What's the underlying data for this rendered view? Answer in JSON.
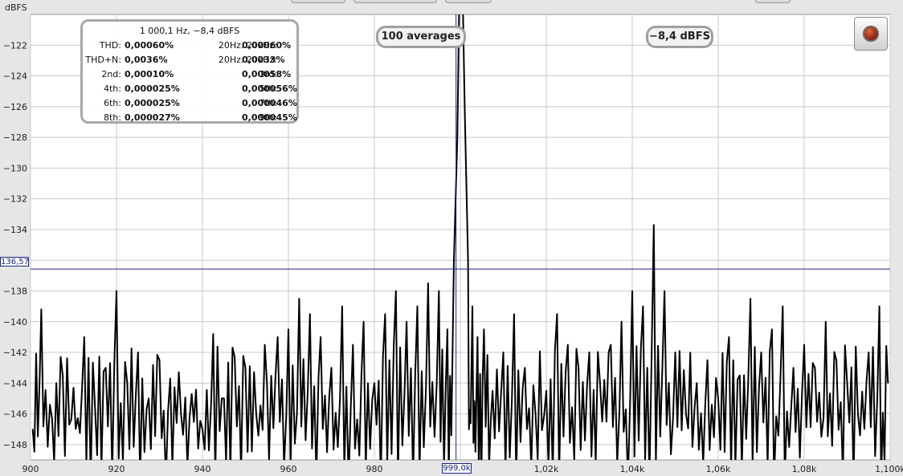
{
  "chart_data": {
    "type": "line",
    "title": "",
    "xlabel": "",
    "ylabel": "dBFS",
    "xlim": [
      900,
      1100
    ],
    "ylim": [
      -149,
      -120
    ],
    "grid": true,
    "x_ticks": [
      {
        "v": 900,
        "label": "900"
      },
      {
        "v": 920,
        "label": "920"
      },
      {
        "v": 940,
        "label": "940"
      },
      {
        "v": 960,
        "label": "960"
      },
      {
        "v": 980,
        "label": "980"
      },
      {
        "v": 1000,
        "label": "999,0k"
      },
      {
        "v": 1020,
        "label": "1,02k"
      },
      {
        "v": 1040,
        "label": "1,04k"
      },
      {
        "v": 1060,
        "label": "1,06k"
      },
      {
        "v": 1080,
        "label": "1,08k"
      },
      {
        "v": 1100,
        "label": "1,100k"
      }
    ],
    "y_ticks": [
      {
        "v": -122,
        "label": "−122"
      },
      {
        "v": -124,
        "label": "−124"
      },
      {
        "v": -126,
        "label": "−126"
      },
      {
        "v": -128,
        "label": "−128"
      },
      {
        "v": -130,
        "label": "−130"
      },
      {
        "v": -132,
        "label": "−132"
      },
      {
        "v": -134,
        "label": "−134"
      },
      {
        "v": -136,
        "label": "−136"
      },
      {
        "v": -138,
        "label": "−138"
      },
      {
        "v": -140,
        "label": "−140"
      },
      {
        "v": -142,
        "label": "−142"
      },
      {
        "v": -144,
        "label": "−144"
      },
      {
        "v": -146,
        "label": "−146"
      },
      {
        "v": -148,
        "label": "−148"
      }
    ],
    "cursor": {
      "x": 999.0,
      "y": -136.57,
      "y_label": "136,57",
      "x_label": "999,0k",
      "color": "#1a237e"
    },
    "series": [
      {
        "color": "#000000",
        "peaks": [
          {
            "x": 900.5,
            "y": -147.0
          },
          {
            "x": 902.5,
            "y": -139.2
          },
          {
            "x": 905.0,
            "y": -146.3
          },
          {
            "x": 907.5,
            "y": -143.5
          },
          {
            "x": 910.0,
            "y": -144.3
          },
          {
            "x": 912.5,
            "y": -141.0
          },
          {
            "x": 915.0,
            "y": -145.6
          },
          {
            "x": 917.5,
            "y": -143.0
          },
          {
            "x": 920.0,
            "y": -138.0
          },
          {
            "x": 922.5,
            "y": -144.0
          },
          {
            "x": 925.0,
            "y": -142.0
          },
          {
            "x": 927.5,
            "y": -145.0
          },
          {
            "x": 930.0,
            "y": -142.5
          },
          {
            "x": 932.5,
            "y": -143.7
          },
          {
            "x": 935.0,
            "y": -146.0
          },
          {
            "x": 937.5,
            "y": -144.7
          },
          {
            "x": 940.0,
            "y": -147.0
          },
          {
            "x": 942.5,
            "y": -140.8
          },
          {
            "x": 945.0,
            "y": -145.0
          },
          {
            "x": 947.5,
            "y": -142.3
          },
          {
            "x": 950.0,
            "y": -143.0
          },
          {
            "x": 952.5,
            "y": -146.0
          },
          {
            "x": 955.0,
            "y": -144.0
          },
          {
            "x": 957.5,
            "y": -141.0
          },
          {
            "x": 960.0,
            "y": -140.5
          },
          {
            "x": 962.5,
            "y": -138.5
          },
          {
            "x": 965.0,
            "y": -139.5
          },
          {
            "x": 967.5,
            "y": -141.0
          },
          {
            "x": 970.0,
            "y": -143.0
          },
          {
            "x": 972.5,
            "y": -139.0
          },
          {
            "x": 975.0,
            "y": -141.5
          },
          {
            "x": 977.5,
            "y": -140.0
          },
          {
            "x": 980.0,
            "y": -144.0
          },
          {
            "x": 982.5,
            "y": -139.5
          },
          {
            "x": 985.0,
            "y": -138.0
          },
          {
            "x": 987.5,
            "y": -140.0
          },
          {
            "x": 990.0,
            "y": -139.0
          },
          {
            "x": 992.5,
            "y": -137.5
          },
          {
            "x": 995.0,
            "y": -138.0
          },
          {
            "x": 997.0,
            "y": -140.5
          },
          {
            "x": 998.5,
            "y": -136.0
          },
          {
            "x": 999.3,
            "y": -128.0
          },
          {
            "x": 999.8,
            "y": -118.0
          },
          {
            "x": 1000.1,
            "y": -110.0
          },
          {
            "x": 1000.5,
            "y": -118.0
          },
          {
            "x": 1001.0,
            "y": -126.0
          },
          {
            "x": 1001.8,
            "y": -136.0
          },
          {
            "x": 1002.8,
            "y": -139.0
          },
          {
            "x": 1004.0,
            "y": -141.0
          },
          {
            "x": 1005.5,
            "y": -140.5
          },
          {
            "x": 1007.5,
            "y": -144.5
          },
          {
            "x": 1010.0,
            "y": -142.0
          },
          {
            "x": 1012.5,
            "y": -139.5
          },
          {
            "x": 1015.0,
            "y": -143.0
          },
          {
            "x": 1017.5,
            "y": -146.0
          },
          {
            "x": 1020.0,
            "y": -144.5
          },
          {
            "x": 1022.5,
            "y": -139.5
          },
          {
            "x": 1025.0,
            "y": -141.5
          },
          {
            "x": 1027.5,
            "y": -143.0
          },
          {
            "x": 1030.0,
            "y": -142.0
          },
          {
            "x": 1032.5,
            "y": -144.0
          },
          {
            "x": 1035.0,
            "y": -141.5
          },
          {
            "x": 1037.5,
            "y": -140.0
          },
          {
            "x": 1040.0,
            "y": -138.0
          },
          {
            "x": 1042.5,
            "y": -139.0
          },
          {
            "x": 1045.0,
            "y": -133.7
          },
          {
            "x": 1047.5,
            "y": -138.0
          },
          {
            "x": 1050.0,
            "y": -142.0
          },
          {
            "x": 1052.5,
            "y": -146.0
          },
          {
            "x": 1055.0,
            "y": -144.0
          },
          {
            "x": 1057.5,
            "y": -142.5
          },
          {
            "x": 1060.0,
            "y": -145.0
          },
          {
            "x": 1062.5,
            "y": -141.0
          },
          {
            "x": 1065.0,
            "y": -143.5
          },
          {
            "x": 1067.5,
            "y": -138.5
          },
          {
            "x": 1070.0,
            "y": -142.0
          },
          {
            "x": 1072.5,
            "y": -140.5
          },
          {
            "x": 1075.0,
            "y": -139.0
          },
          {
            "x": 1077.5,
            "y": -143.0
          },
          {
            "x": 1080.0,
            "y": -141.5
          },
          {
            "x": 1082.5,
            "y": -143.0
          },
          {
            "x": 1085.0,
            "y": -140.0
          },
          {
            "x": 1087.5,
            "y": -142.5
          },
          {
            "x": 1090.0,
            "y": -144.0
          },
          {
            "x": 1092.5,
            "y": -146.0
          },
          {
            "x": 1095.0,
            "y": -142.0
          },
          {
            "x": 1097.5,
            "y": -139.0
          },
          {
            "x": 1099.5,
            "y": -144.0
          }
        ]
      }
    ]
  },
  "stats": {
    "title": "1 000,1 Hz, −8,4 dBFS",
    "rows": [
      {
        "k1": "THD:",
        "v1": "0,00060%",
        "k2": "20Hz..20kHz:",
        "v2": "0,00060%"
      },
      {
        "k1": "THD+N:",
        "v1": "0,0036%",
        "k2": "20Hz..20kHz:",
        "v2": "0,0033%"
      },
      {
        "k1": "2nd:",
        "v1": "0,00010%",
        "k2": "3rd:",
        "v2": "0,00058%"
      },
      {
        "k1": "4th:",
        "v1": "0,000025%",
        "k2": "5th:",
        "v2": "0,000056%"
      },
      {
        "k1": "6th:",
        "v1": "0,000025%",
        "k2": "7th:",
        "v2": "0,000046%"
      },
      {
        "k1": "8th:",
        "v1": "0,000027%",
        "k2": "9th:",
        "v2": "0,000045%"
      }
    ]
  },
  "averages_label": "100 averages",
  "level_label": "−8,4 dBFS",
  "record_button": {
    "icon": "record-icon"
  }
}
